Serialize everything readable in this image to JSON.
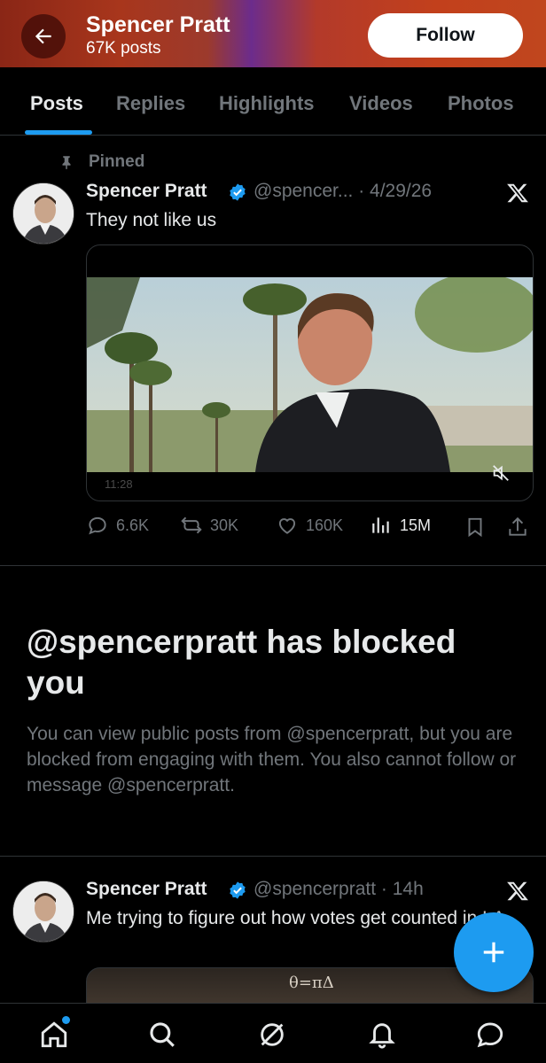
{
  "header": {
    "name": "Spencer Pratt",
    "post_count": "67K posts",
    "follow_label": "Follow"
  },
  "tabs": [
    {
      "label": "Posts",
      "active": true
    },
    {
      "label": "Replies",
      "active": false
    },
    {
      "label": "Highlights",
      "active": false
    },
    {
      "label": "Videos",
      "active": false
    },
    {
      "label": "Photos",
      "active": false
    }
  ],
  "pinned_post": {
    "pinned_label": "Pinned",
    "author": "Spencer Pratt",
    "handle_date": "@spencer... · 4/29/26",
    "text": "They not like us",
    "video_time": "11:28",
    "stats": {
      "replies": "6.6K",
      "reposts": "30K",
      "likes": "160K",
      "views": "15M"
    }
  },
  "blocked_notice": {
    "title": "@spencerpratt has blocked you",
    "body": "You can view public posts from @spencerpratt, but you are blocked from engaging with them. You also cannot follow or message @spencerpratt."
  },
  "second_post": {
    "author": "Spencer Pratt",
    "handle_date": "@spencerpratt · 14h",
    "text": "Me trying to figure out how votes get counted in LA",
    "chalk_text": "θ=πΔ"
  },
  "colors": {
    "accent": "#1d9bf0",
    "muted": "#71767b",
    "text": "#e7e9ea",
    "background": "#000000"
  },
  "icons": [
    "back-arrow-icon",
    "pin-icon",
    "verified-badge-icon",
    "x-logo-icon",
    "mute-icon",
    "reply-icon",
    "repost-icon",
    "like-icon",
    "views-icon",
    "bookmark-icon",
    "share-icon",
    "compose-plus-icon",
    "home-icon",
    "search-icon",
    "grok-icon",
    "notifications-icon",
    "messages-icon"
  ]
}
